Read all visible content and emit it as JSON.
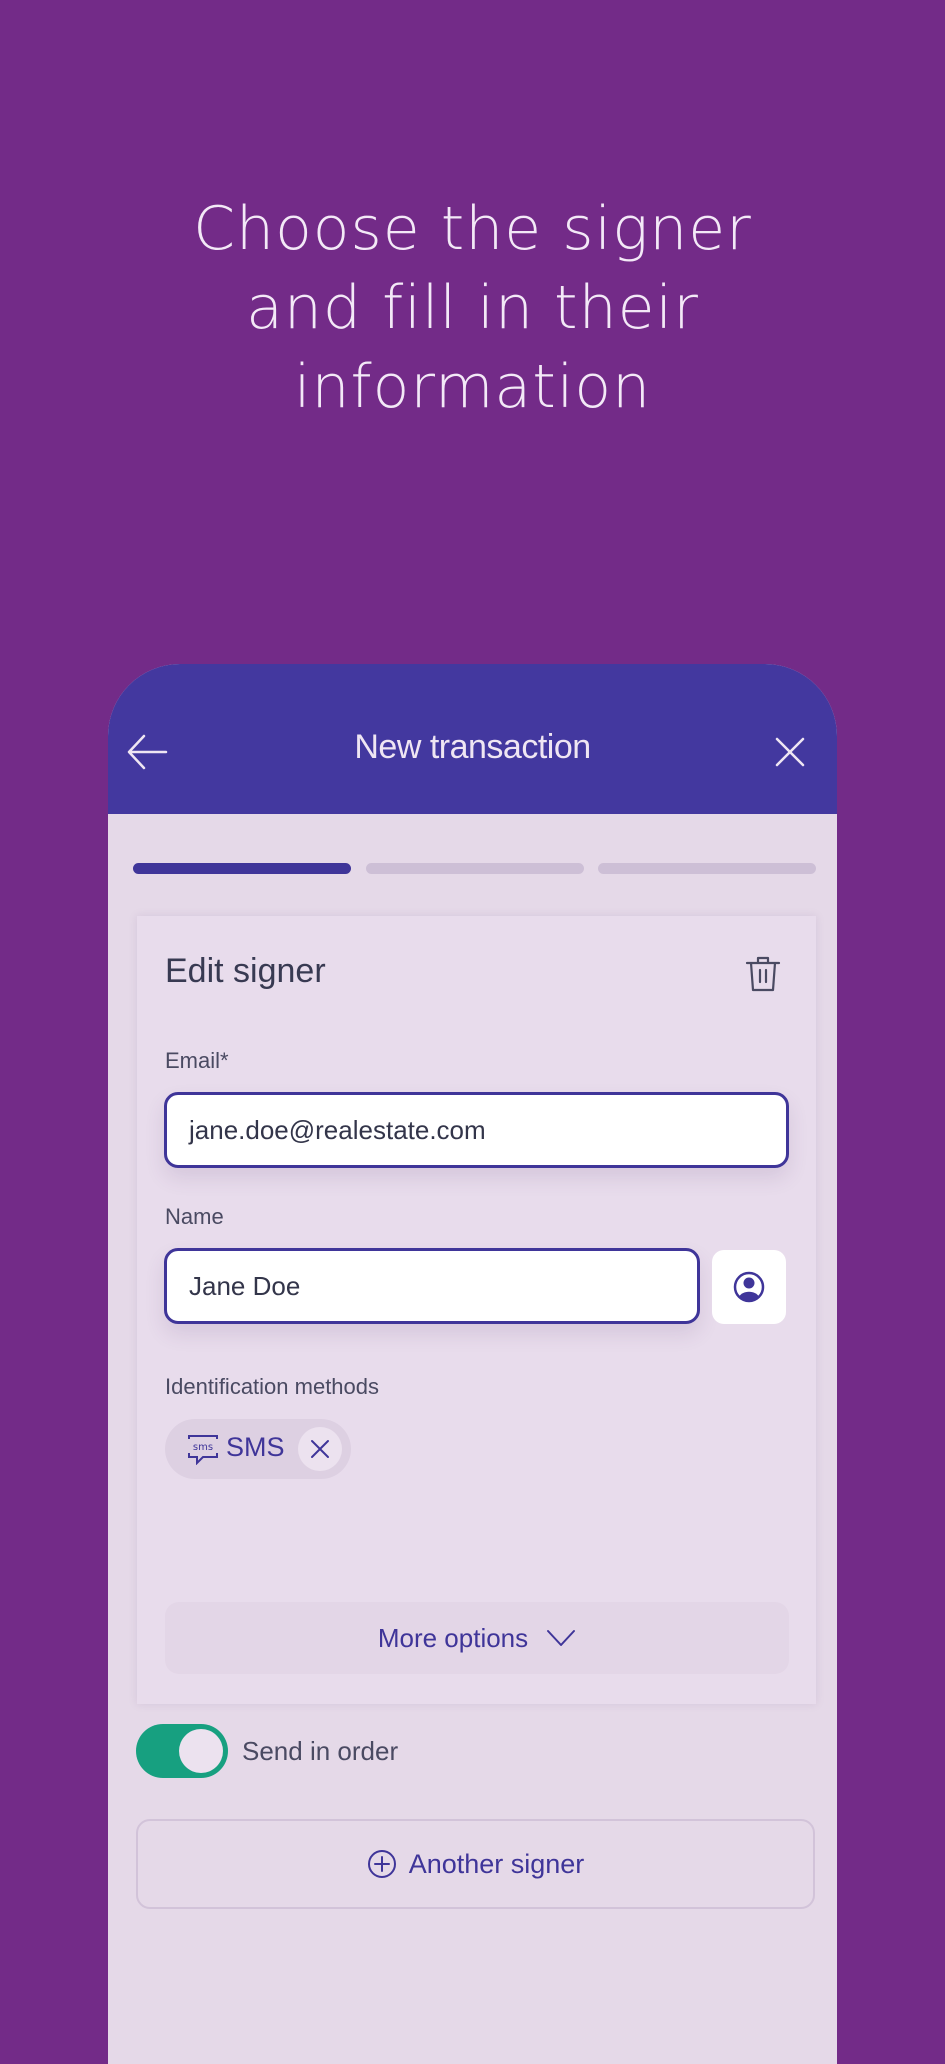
{
  "headline": {
    "lines": [
      "Choose the signer",
      "and fill in their",
      "information"
    ]
  },
  "appbar": {
    "title": "New transaction",
    "back_icon": "arrow-left-icon",
    "close_icon": "close-icon"
  },
  "progress": {
    "total_steps": 3,
    "current_step": 1
  },
  "card": {
    "title": "Edit signer",
    "delete_icon": "trash-icon",
    "email": {
      "label": "Email*",
      "value": "jane.doe@realestate.com"
    },
    "name": {
      "label": "Name",
      "value": "Jane Doe",
      "contact_icon": "user-circle-icon"
    },
    "identification": {
      "label": "Identification methods",
      "chips": [
        {
          "label": "SMS",
          "icon": "sms-icon",
          "remove_icon": "close-icon"
        }
      ]
    },
    "more_options": {
      "label": "More options",
      "icon": "chevron-down-icon"
    }
  },
  "send_in_order": {
    "label": "Send in order",
    "enabled": true
  },
  "another_signer": {
    "label": "Another signer",
    "icon": "plus-circle-icon"
  },
  "colors": {
    "background": "#732b88",
    "appbar": "#43389f",
    "accent": "#3f3599",
    "toggle_on": "#17a080",
    "surface": "#e5d9e8"
  }
}
